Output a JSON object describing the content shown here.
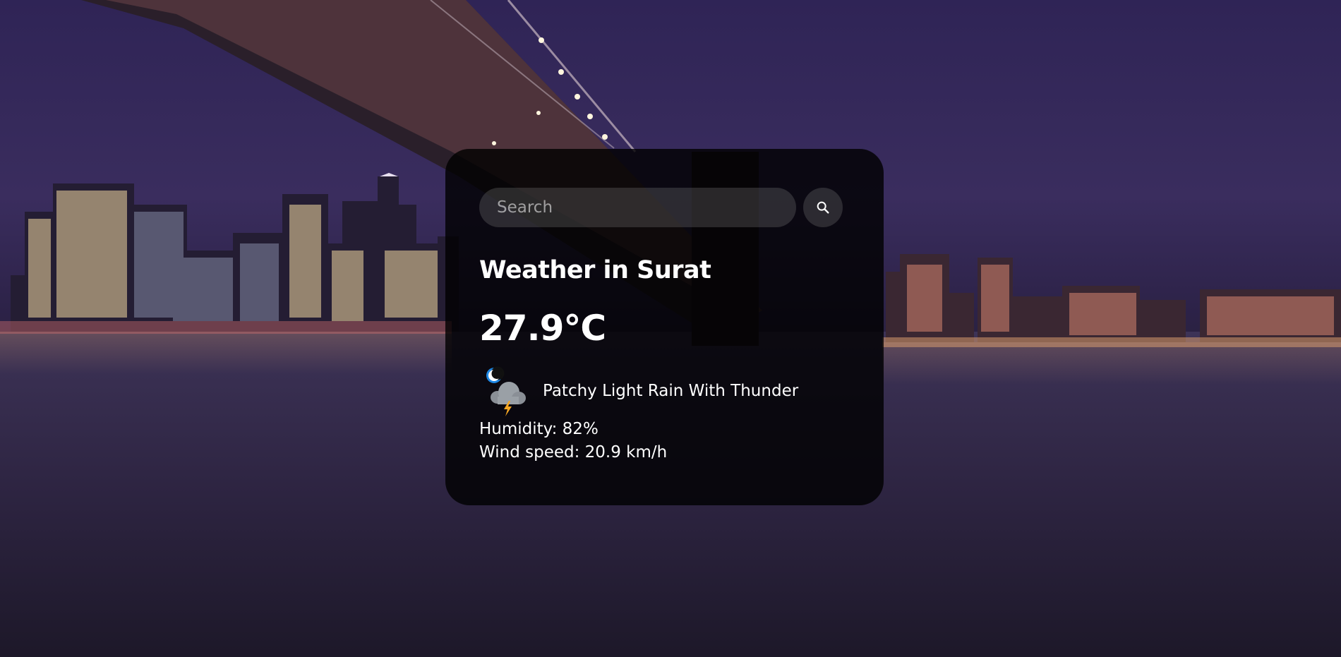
{
  "search": {
    "placeholder": "Search",
    "button_icon": "search-icon"
  },
  "weather": {
    "title": "Weather in Surat",
    "temperature": "27.9°C",
    "condition_icon": "night-thunder-rain-icon",
    "condition": "Patchy Light Rain With Thunder",
    "humidity": "Humidity: 82%",
    "wind": "Wind speed: 20.9 km/h"
  },
  "colors": {
    "card_background": "#000000",
    "text": "#ffffff",
    "sky": "#2f2456"
  }
}
